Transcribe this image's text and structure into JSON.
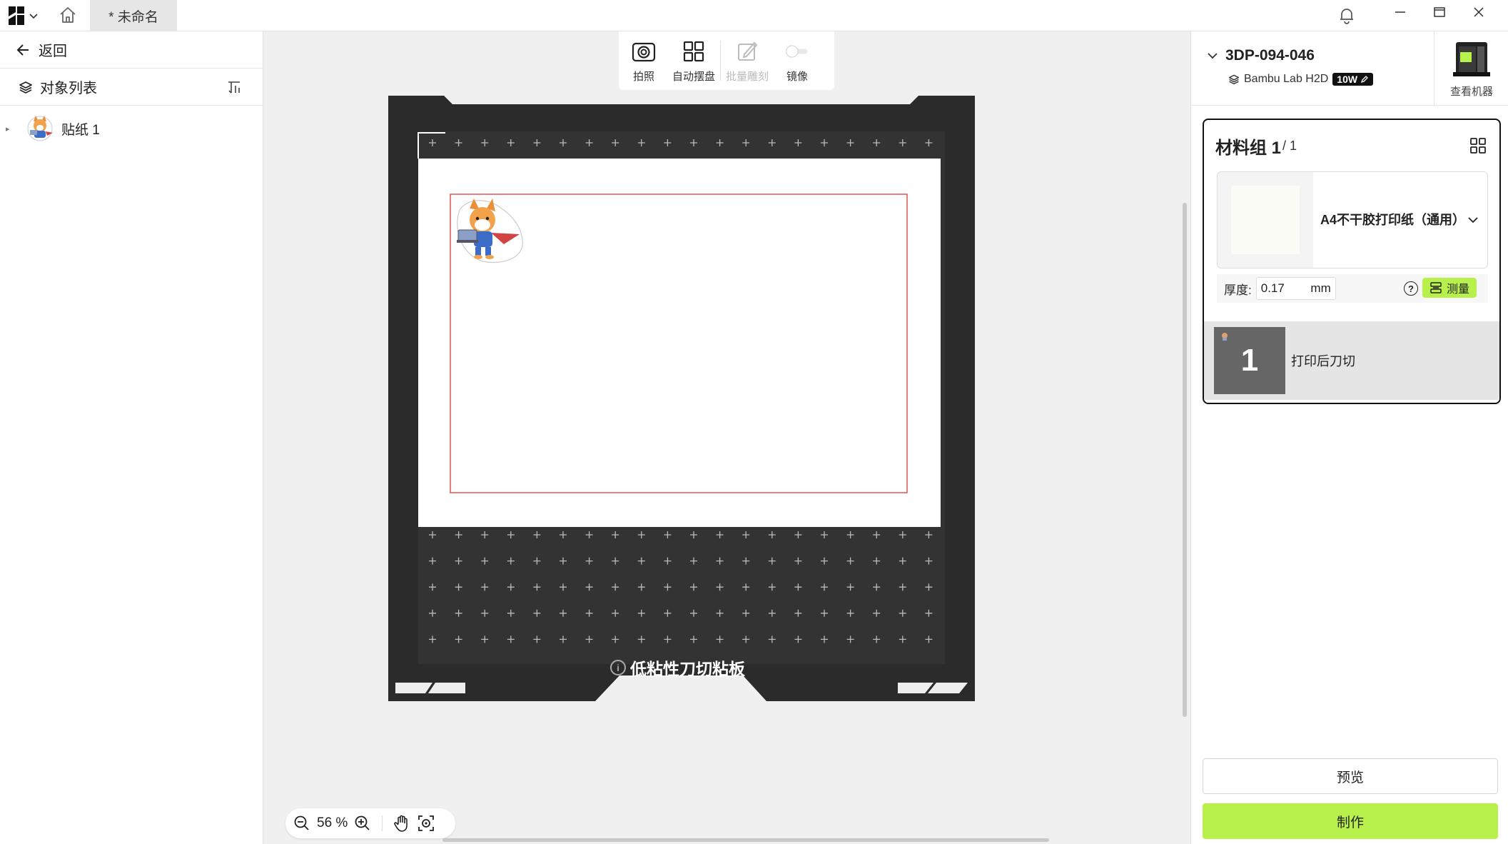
{
  "titlebar": {
    "tab_title": "* 未命名"
  },
  "left_panel": {
    "back_label": "返回",
    "object_list_title": "对象列表",
    "objects": [
      {
        "name": "贴纸 1"
      }
    ]
  },
  "toolbar": {
    "photo_label": "拍照",
    "auto_arrange_label": "自动摆盘",
    "batch_engrave_label": "批量雕刻",
    "mirror_label": "镜像"
  },
  "plate": {
    "label": "低粘性刀切粘板"
  },
  "zoom": {
    "value": "56 %"
  },
  "printer": {
    "name": "3DP-094-046",
    "model": "Bambu Lab H2D",
    "laser_badge": "10W",
    "view_machine_label": "查看机器"
  },
  "material_group": {
    "title": "材料组 1",
    "count": "/ 1",
    "paper_name": "A4不干胶打印纸（通用）",
    "thickness_label": "厚度:",
    "thickness_value": "0.17",
    "thickness_unit": "mm",
    "measure_label": "测量",
    "task_number": "1",
    "task_label": "打印后刀切"
  },
  "actions": {
    "preview_label": "预览",
    "make_label": "制作"
  },
  "colors": {
    "accent_green": "#b8f04c",
    "plate_dark": "#2b2b2b",
    "cut_border_red": "#e05555"
  }
}
